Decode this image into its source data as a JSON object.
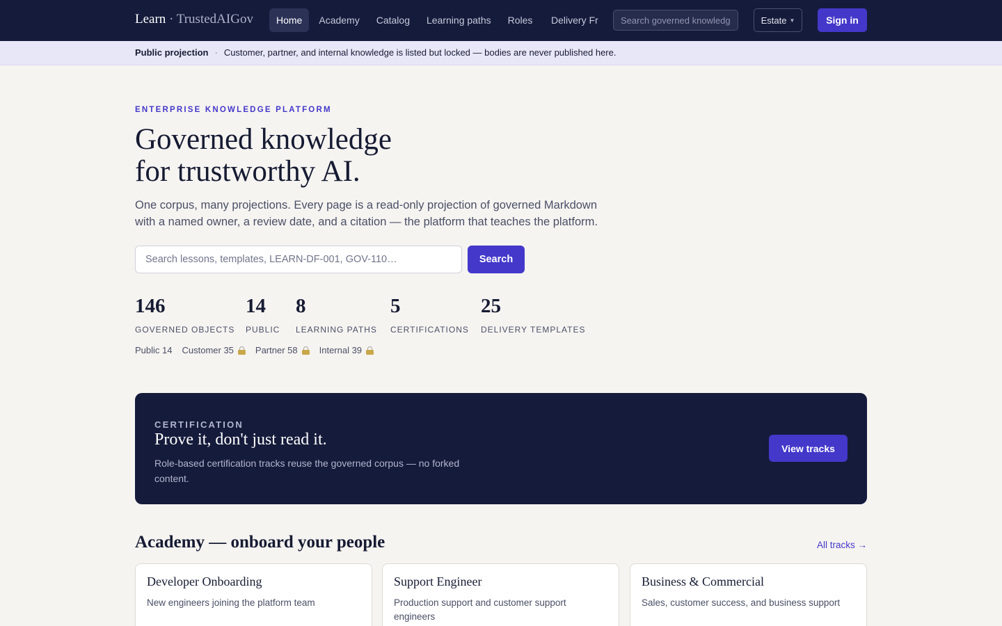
{
  "header": {
    "brand": "Learn",
    "brand_separator": " · ",
    "brand_sub": "TrustedAIGov",
    "nav": [
      "Home",
      "Academy",
      "Catalog",
      "Learning paths",
      "Roles",
      "Delivery Fr"
    ],
    "search_placeholder": "Search governed knowledge",
    "estate_label": "Estate",
    "signin_label": "Sign in"
  },
  "notice": {
    "label": "Public projection",
    "separator": "·",
    "text": "Customer, partner, and internal knowledge is listed but locked — bodies are never published here."
  },
  "hero": {
    "eyebrow": "ENTERPRISE KNOWLEDGE PLATFORM",
    "title_line1": "Governed knowledge",
    "title_line2": "for trustworthy AI.",
    "lead": "One corpus, many projections. Every page is a read-only projection of governed Markdown with a named owner, a review date, and a citation — the platform that teaches the platform.",
    "search_placeholder": "Search lessons, templates, LEARN-DF-001, GOV-110…",
    "search_button": "Search"
  },
  "stats": [
    {
      "value": "146",
      "label": "GOVERNED OBJECTS"
    },
    {
      "value": "14",
      "label": "PUBLIC"
    },
    {
      "value": "8",
      "label": "LEARNING PATHS"
    },
    {
      "value": "5",
      "label": "CERTIFICATIONS"
    },
    {
      "value": "25",
      "label": "DELIVERY TEMPLATES"
    }
  ],
  "visibility": [
    {
      "label": "Public 14",
      "locked": false
    },
    {
      "label": "Customer 35",
      "locked": true
    },
    {
      "label": "Partner 58",
      "locked": true
    },
    {
      "label": "Internal 39",
      "locked": true
    }
  ],
  "certification": {
    "eyebrow": "CERTIFICATION",
    "title": "Prove it, don't just read it.",
    "text": "Role-based certification tracks reuse the governed corpus — no forked content.",
    "button": "View tracks"
  },
  "academy": {
    "title": "Academy — onboard your people",
    "link": "All tracks →",
    "cards": [
      {
        "title": "Developer Onboarding",
        "desc": "New engineers joining the platform team"
      },
      {
        "title": "Support Engineer",
        "desc": "Production support and customer support engineers"
      },
      {
        "title": "Business & Commercial",
        "desc": "Sales, customer success, and business support"
      }
    ]
  },
  "colors": {
    "navy": "#151b3b",
    "accent": "#4338ca",
    "background": "#f6f4f1",
    "notice_bg": "#e8e7f8"
  }
}
